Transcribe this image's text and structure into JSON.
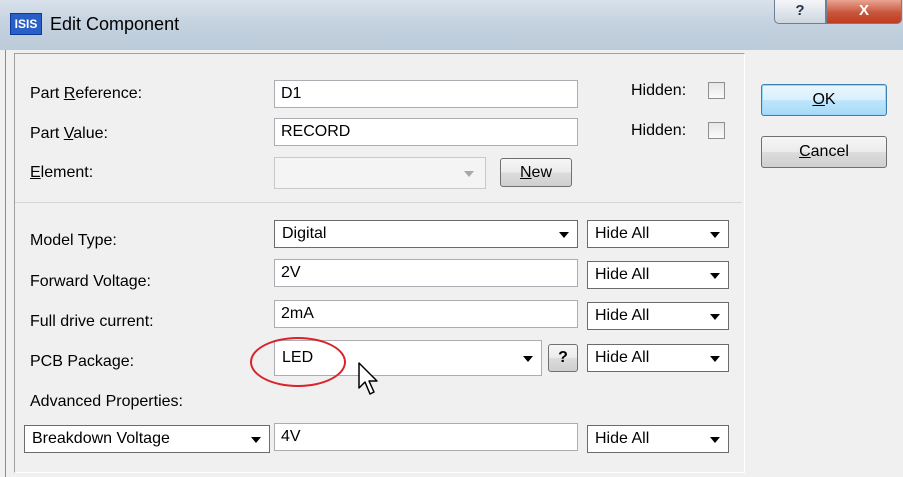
{
  "window": {
    "title": "Edit Component",
    "app_icon_text": "ISIS",
    "help_glyph": "?",
    "close_glyph": "X"
  },
  "part_reference": {
    "label_pre": "Part ",
    "label_key": "R",
    "label_post": "eference:",
    "value": "D1",
    "hidden_label": "Hidden:",
    "hidden_checked": false
  },
  "part_value": {
    "label_pre": "Part ",
    "label_key": "V",
    "label_post": "alue:",
    "value": "RECORD",
    "hidden_label": "Hidden:",
    "hidden_checked": false
  },
  "element": {
    "label_key": "E",
    "label_post": "lement:",
    "value": "",
    "new_key": "N",
    "new_post": "ew"
  },
  "properties": [
    {
      "label": "Model Type:",
      "value": "Digital",
      "visibility": "Hide All"
    },
    {
      "label": "Forward Voltage:",
      "value": "2V",
      "visibility": "Hide All"
    },
    {
      "label": "Full drive current:",
      "value": "2mA",
      "visibility": "Hide All"
    },
    {
      "label": "PCB Package:",
      "value": "LED",
      "visibility": "Hide All",
      "help": "?"
    }
  ],
  "advanced": {
    "label": "Advanced Properties:",
    "property": "Breakdown Voltage",
    "value": "4V",
    "visibility": "Hide All"
  },
  "buttons": {
    "ok_key": "O",
    "ok_post": "K",
    "cancel_key": "C",
    "cancel_post": "ancel"
  },
  "colors": {
    "annotation_circle": "#d8232a",
    "titlebar": "#c5d2df",
    "dialog_bg": "#f0f0f0"
  }
}
